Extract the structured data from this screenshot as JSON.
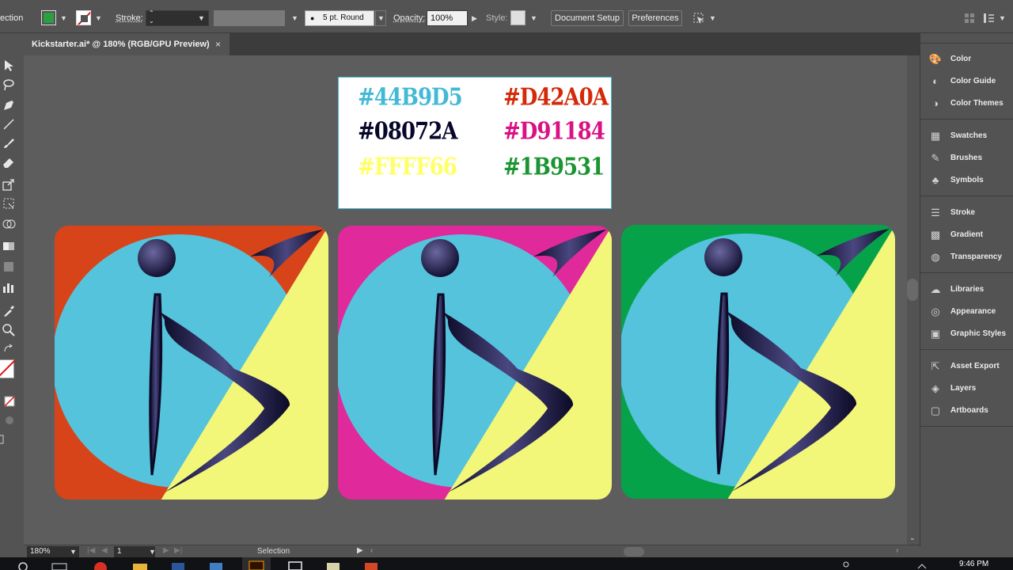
{
  "control_bar": {
    "selection_label": "ection",
    "stroke_label": "Stroke:",
    "brush_value": "5 pt. Round",
    "opacity_label": "Opacity:",
    "opacity_value": "100%",
    "style_label": "Style:",
    "document_setup_label": "Document Setup",
    "preferences_label": "Preferences",
    "fill_color": "#2aa043",
    "style_swatch_color": "#e0e0e0"
  },
  "document_tab": {
    "title": "Kickstarter.ai* @ 180% (RGB/GPU Preview)",
    "close_glyph": "×"
  },
  "palette_card": {
    "colors": [
      {
        "hex": "#44B9D5",
        "color": "#44b9d5"
      },
      {
        "hex": "#D42A0A",
        "color": "#d42a0a"
      },
      {
        "hex": "#08072A",
        "color": "#08072a"
      },
      {
        "hex": "#D91184",
        "color": "#d91184"
      },
      {
        "hex": "#FFFF66",
        "color": "#ffff66"
      },
      {
        "hex": "#1B9531",
        "color": "#1b9531"
      }
    ]
  },
  "logos": [
    {
      "name": "logo-red",
      "bg": "#d8441a",
      "circle": "#55c3dc",
      "wedge": "#f3f779",
      "mark": "#1c1743"
    },
    {
      "name": "logo-magenta",
      "bg": "#e0299a",
      "circle": "#55c3dc",
      "wedge": "#f3f779",
      "mark": "#1c1743"
    },
    {
      "name": "logo-green",
      "bg": "#06a24a",
      "circle": "#55c3dc",
      "wedge": "#f3f779",
      "mark": "#1c1743"
    }
  ],
  "status_bar": {
    "zoom": "180%",
    "artboard": "1",
    "tool": "Selection"
  },
  "right_panel": {
    "groups": [
      [
        {
          "label": "Color",
          "icon": "palette-icon"
        },
        {
          "label": "Color Guide",
          "icon": "color-guide-icon"
        },
        {
          "label": "Color Themes",
          "icon": "color-themes-icon"
        }
      ],
      [
        {
          "label": "Swatches",
          "icon": "swatches-icon"
        },
        {
          "label": "Brushes",
          "icon": "brushes-icon"
        },
        {
          "label": "Symbols",
          "icon": "symbols-icon"
        }
      ],
      [
        {
          "label": "Stroke",
          "icon": "stroke-icon"
        },
        {
          "label": "Gradient",
          "icon": "gradient-icon"
        },
        {
          "label": "Transparency",
          "icon": "transparency-icon"
        }
      ],
      [
        {
          "label": "Libraries",
          "icon": "libraries-icon"
        },
        {
          "label": "Appearance",
          "icon": "appearance-icon"
        },
        {
          "label": "Graphic Styles",
          "icon": "graphic-styles-icon"
        }
      ],
      [
        {
          "label": "Asset Export",
          "icon": "asset-export-icon"
        },
        {
          "label": "Layers",
          "icon": "layers-icon"
        },
        {
          "label": "Artboards",
          "icon": "artboards-icon"
        }
      ]
    ]
  },
  "taskbar": {
    "time": "9:46 PM"
  }
}
